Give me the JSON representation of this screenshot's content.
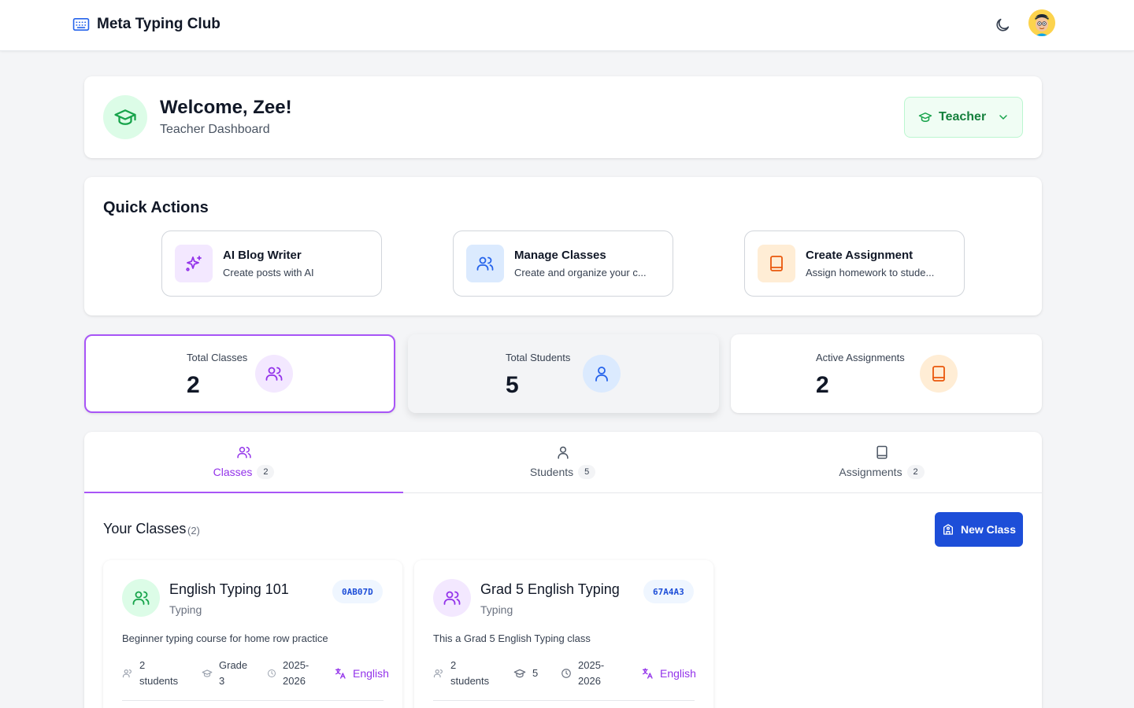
{
  "app": {
    "title": "Meta Typing Club"
  },
  "welcome": {
    "title": "Welcome, Zee!",
    "subtitle": "Teacher Dashboard",
    "role_label": "Teacher"
  },
  "quick_actions": {
    "title": "Quick Actions",
    "items": [
      {
        "title": "AI Blog Writer",
        "subtitle": "Create posts with AI",
        "icon": "sparkles-icon",
        "color": "#9333ea"
      },
      {
        "title": "Manage Classes",
        "subtitle": "Create and organize your c...",
        "icon": "users-icon",
        "color": "#2563eb"
      },
      {
        "title": "Create Assignment",
        "subtitle": "Assign homework to stude...",
        "icon": "book-icon",
        "color": "#ea580c"
      }
    ]
  },
  "stats": [
    {
      "label": "Total Classes",
      "value": "2",
      "icon": "users-icon"
    },
    {
      "label": "Total Students",
      "value": "5",
      "icon": "user-icon"
    },
    {
      "label": "Active Assignments",
      "value": "2",
      "icon": "book-icon"
    }
  ],
  "tabs": [
    {
      "label": "Classes",
      "count": "2",
      "icon": "users-icon"
    },
    {
      "label": "Students",
      "count": "5",
      "icon": "user-icon"
    },
    {
      "label": "Assignments",
      "count": "2",
      "icon": "book-icon"
    }
  ],
  "classes_section": {
    "title": "Your Classes",
    "count": "(2)",
    "new_button": "New Class"
  },
  "classes": [
    {
      "name": "English Typing 101",
      "subject": "Typing",
      "code": "0AB07D",
      "description": "Beginner typing course for home row practice",
      "students_num": "2",
      "students_word": "students",
      "grade_line1": "Grade",
      "grade_line2": "3",
      "year_line1": "2025-",
      "year_line2": "2026",
      "language": "English"
    },
    {
      "name": "Grad 5 English Typing",
      "subject": "Typing",
      "code": "67A4A3",
      "description": "This a Grad 5 English Typing class",
      "students_num": "2",
      "students_word": "students",
      "grade": "5",
      "year_line1": "2025-",
      "year_line2": "2026",
      "language": "English"
    }
  ],
  "colors": {
    "purple": "#9333ea",
    "blue": "#1d4ed8",
    "green": "#16a34a",
    "orange": "#ea580c"
  }
}
